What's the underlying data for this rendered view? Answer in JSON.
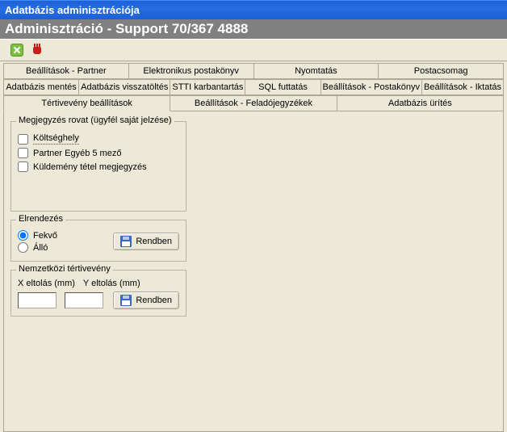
{
  "window": {
    "title": "Adatbázis adminisztrációja",
    "subtitle": "Adminisztráció - Support 70/367 4888"
  },
  "toolbar": {
    "close_name": "close",
    "stop_name": "stop"
  },
  "tabs": {
    "row1": [
      "Beállítások - Partner",
      "Elektronikus postakönyv",
      "Nyomtatás",
      "Postacsomag"
    ],
    "row2": [
      "Adatbázis mentés",
      "Adatbázis visszatöltés",
      "STTI karbantartás",
      "SQL futtatás",
      "Beállítások - Postakönyv",
      "Beállítások - Iktatás"
    ],
    "row3": [
      "Tértivevény beállítások",
      "Beállítások - Feladójegyzékek",
      "Adatbázis ürítés"
    ],
    "active": "Tértivevény beállítások"
  },
  "group_note": {
    "title": "Megjegyzés rovat (ügyfél saját jelzése)",
    "items": [
      "Költséghely",
      "Partner Egyéb 5 mező",
      "Küldemény tétel megjegyzés"
    ]
  },
  "group_layout": {
    "title": "Elrendezés",
    "options": [
      "Fekvő",
      "Álló"
    ],
    "selected": 0,
    "ok_label": "Rendben"
  },
  "group_intl": {
    "title": "Nemzetközi tértivevény",
    "x_label": "X eltolás (mm)",
    "y_label": "Y eltolás (mm)",
    "x_value": "",
    "y_value": "",
    "ok_label": "Rendben"
  }
}
